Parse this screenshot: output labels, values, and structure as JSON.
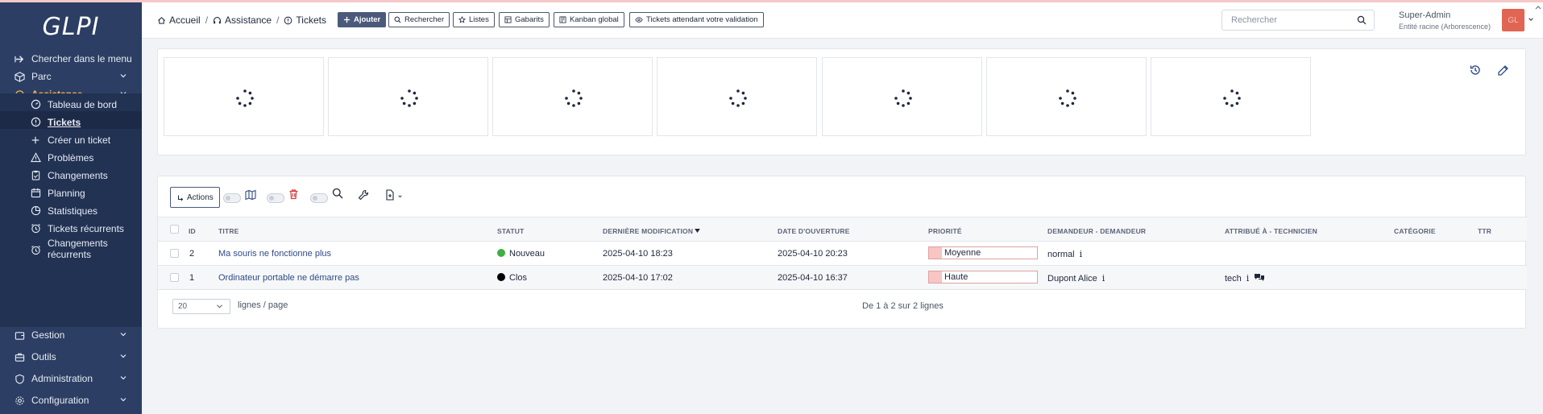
{
  "brand": {
    "logo": "GLPI"
  },
  "sidebar": {
    "items": [
      {
        "label": "Chercher dans le menu",
        "icon": "arrow-right-icon"
      },
      {
        "label": "Parc",
        "icon": "box-icon"
      },
      {
        "label": "Assistance",
        "icon": "headset-icon"
      },
      {
        "label": "Gestion",
        "icon": "wallet-icon"
      },
      {
        "label": "Outils",
        "icon": "briefcase-icon"
      },
      {
        "label": "Administration",
        "icon": "shield-icon"
      },
      {
        "label": "Configuration",
        "icon": "gear-icon"
      }
    ],
    "assistance_sub": [
      {
        "label": "Tableau de bord",
        "icon": "gauge-icon"
      },
      {
        "label": "Tickets",
        "icon": "alert-circle-icon"
      },
      {
        "label": "Créer un ticket",
        "icon": "plus-icon"
      },
      {
        "label": "Problèmes",
        "icon": "warning-icon"
      },
      {
        "label": "Changements",
        "icon": "clipboard-icon"
      },
      {
        "label": "Planning",
        "icon": "calendar-icon"
      },
      {
        "label": "Statistiques",
        "icon": "chart-icon"
      },
      {
        "label": "Tickets récurrents",
        "icon": "alarm-icon"
      },
      {
        "label": "Changements",
        "label2": "récurrents",
        "icon": "alarm-icon"
      }
    ]
  },
  "breadcrumb": {
    "home": "Accueil",
    "section": "Assistance",
    "page": "Tickets"
  },
  "toolbar": {
    "add": "Ajouter",
    "search": "Rechercher",
    "lists": "Listes",
    "templates": "Gabarits",
    "kanban": "Kanban global",
    "validation": "Tickets attendant votre validation"
  },
  "global_search": {
    "placeholder": "Rechercher"
  },
  "user": {
    "name": "Super-Admin",
    "entity": "Entité racine (Arborescence)",
    "initials": "GL"
  },
  "table": {
    "actions_label": "Actions",
    "columns": [
      "ID",
      "TITRE",
      "STATUT",
      "DERNIÈRE MODIFICATION",
      "DATE D'OUVERTURE",
      "PRIORITÉ",
      "DEMANDEUR - DEMANDEUR",
      "ATTRIBUÉ À - TECHNICIEN",
      "CATÉGORIE",
      "TTR"
    ],
    "rows": [
      {
        "id": "2",
        "title": "Ma souris ne fonctionne plus",
        "status": "Nouveau",
        "status_color": "#3cb043",
        "modified": "2025-04-10 18:23",
        "opened": "2025-04-10 20:23",
        "priority": "Moyenne",
        "requester": "normal",
        "technician": ""
      },
      {
        "id": "1",
        "title": "Ordinateur portable ne démarre pas",
        "status": "Clos",
        "status_color": "#000000",
        "modified": "2025-04-10 17:02",
        "opened": "2025-04-10 16:37",
        "priority": "Haute",
        "requester": "Dupont Alice",
        "technician": "tech"
      }
    ],
    "page_size": "20",
    "per_page_label": "lignes / page",
    "count_text": "De 1 à 2 sur 2 lignes"
  },
  "colors": {
    "sidebar": "#2c3e63",
    "accent": "#f7b749",
    "primary_button": "#4b5a7a",
    "avatar": "#e06552"
  }
}
